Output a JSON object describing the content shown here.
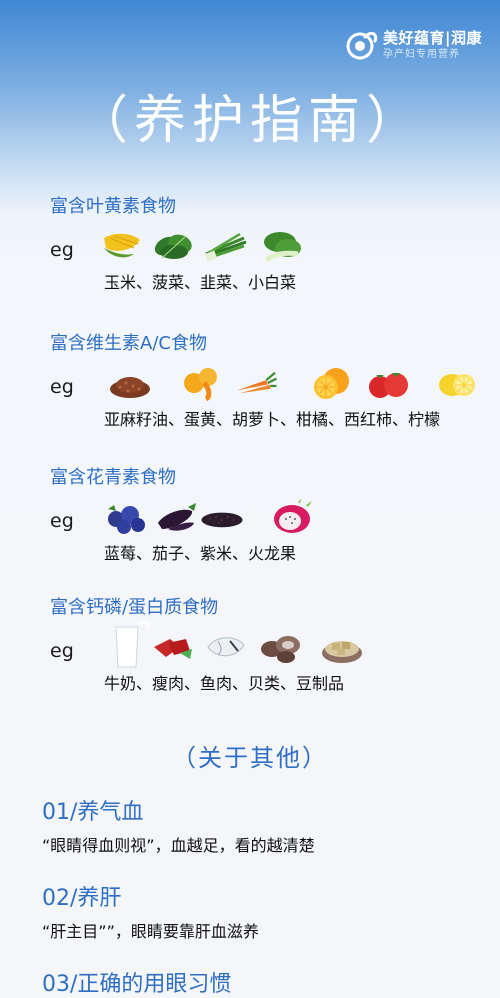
{
  "brand": {
    "name": "美好蕴育|润康",
    "slogan": "孕产妇专用营养"
  },
  "title": "（养护指南）",
  "sections": [
    {
      "title": "富含叶黄素食物",
      "eg": "eg",
      "icons": [
        "corn-icon",
        "spinach-icon",
        "chives-icon",
        "bok-choy-icon"
      ],
      "foods": "玉米、菠菜、韭菜、小白菜"
    },
    {
      "title": "富含维生素A/C食物",
      "eg": "eg",
      "icons": [
        "flaxseed-icon",
        "egg-yolk-icon",
        "carrot-icon",
        "orange-icon",
        "tomato-icon",
        "lemon-icon"
      ],
      "foods": "亚麻籽油、蛋黄、胡萝卜、柑橘、西红柿、柠檬"
    },
    {
      "title": "富含花青素食物",
      "eg": "eg",
      "icons": [
        "blueberry-icon",
        "eggplant-icon",
        "black-rice-icon",
        "dragon-fruit-icon"
      ],
      "foods": "蓝莓、茄子、紫米、火龙果"
    },
    {
      "title": "富含钙磷/蛋白质食物",
      "eg": "eg",
      "icons": [
        "milk-icon",
        "lean-meat-icon",
        "fish-icon",
        "shellfish-icon",
        "tofu-icon"
      ],
      "foods": "牛奶、瘦肉、鱼肉、贝类、豆制品"
    }
  ],
  "other_title": "（关于其他）",
  "tips": [
    {
      "title": "01/养气血",
      "desc": "“眼睛得血则视”，血越足，看的越清楚"
    },
    {
      "title": "02/养肝",
      "desc": "“肝主目””，眼睛要靠肝血滋养"
    },
    {
      "title": "03/正确的用眼习惯",
      "desc": ""
    }
  ],
  "colors": {
    "accent": "#2f6fc4",
    "header_blue": "#3f87d3",
    "background": "#f4f6f9"
  }
}
